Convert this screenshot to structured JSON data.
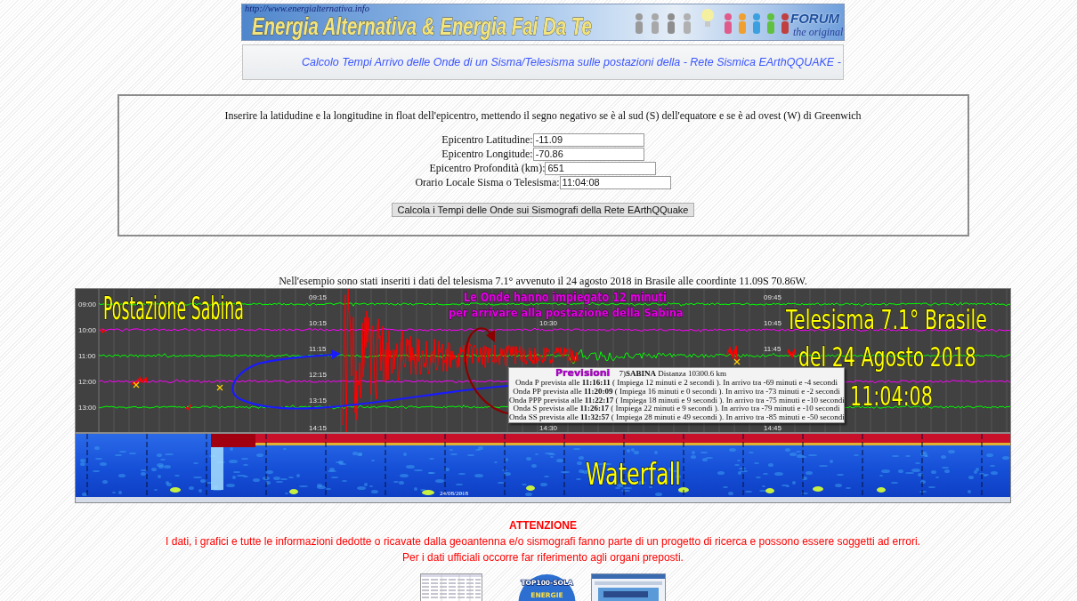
{
  "header": {
    "url": "http://www.energialternativa.info",
    "title": "Energia Alternativa & Energia Fai Da Te",
    "forum_title": "FORUM",
    "forum_subtitle": "the original"
  },
  "subheader": {
    "title": "Calcolo Tempi Arrivo delle Onde di un Sisma/Telesisma sulle postazioni della - Rete Sismica EArthQQUAKE -"
  },
  "form": {
    "instruction": "Inserire la latidudine e la longitudine in float dell'epicentro, mettendo il segno negativo se è al sud (S) dell'equatore e se è ad ovest (W) di Greenwich",
    "fields": [
      {
        "label": "Epicentro Latitudine:",
        "value": "-11.09"
      },
      {
        "label": "Epicentro Longitude:",
        "value": "-70.86"
      },
      {
        "label": "Epicentro Profondità (km):",
        "value": "651"
      },
      {
        "label": "Orario Locale Sisma o Telesisma:",
        "value": "11:04:08"
      }
    ],
    "submit_button": "Calcola i Tempi delle Onde sui Sismografi della Rete EArthQQuake"
  },
  "example_note": "Nell'esempio sono stati inseriti i dati del telesisma 7.1° avvenuto il 24 agosto 2018 in Brasile alle coordinte 11.09S 70.86W.",
  "seismogram": {
    "station_title": "Postazione Sabina",
    "rows": [
      {
        "time": "09:00",
        "color": "#00ff00",
        "column_2": "09:15",
        "column_4": "09:45"
      },
      {
        "time": "10:00",
        "color": "#ff00ff",
        "column_2": "10:15",
        "column_3": "10:30",
        "column_4": "10:45"
      },
      {
        "time": "11:00",
        "color": "#00ff00",
        "column_2": "11:15",
        "column_4": "11:45"
      },
      {
        "time": "12:00",
        "color": "#ff00ff",
        "column_2": "12:15"
      },
      {
        "time": "13:00",
        "color": "#00ff00",
        "column_2": "13:15"
      },
      {
        "column_2": "14:15",
        "column_3": "14:30",
        "column_4": "14:45"
      }
    ],
    "annotation": [
      "Le Onde hanno impiegato 12 minuti",
      "per arrivare alla postazione della Sabina"
    ],
    "event_title": [
      "Telesisma 7.1° Brasile",
      "del 24 Agosto 2018",
      "11:04:08"
    ],
    "forecast": {
      "title": "Previsioni",
      "station": "7)**SABINA** Distanza 10300.6 km",
      "lines": [
        "Onda P prevista alle **11:16:11** ( Impiega 12 minuti e 2 secondi ). In arrivo tra -69 minuti e -4 secondi",
        "Onda PP prevista alle **11:20:09** ( Impiega 16 minuti e 0 secondi ). In arrivo tra -73 minuti e -2 secondi",
        "Onda PPP prevista alle **11:22:17** ( Impiega 18 minuti e 9 secondi ). In arrivo tra -75 minuti e -10 secondi",
        "Onda S prevista alle **11:26:17** ( Impiega 22 minuti e 9 secondi ). In arrivo tra -79 minuti e -10 secondi",
        "Onda SS prevista alle **11:32:57** ( Impiega 28 minuti e 49 secondi ). In arrivo tra -85 minuti e -50 secondi"
      ]
    }
  },
  "waterfall": {
    "title": "Waterfall",
    "date": "24/08/2018"
  },
  "notice": {
    "title": "ATTENZIONE",
    "lines": [
      "I dati, i grafici e tutte le informazioni dedotte o ricavate dalla geoantenna e/o sismografi fanno parte di un progetto di ricerca e possono essere soggetti ad errori.",
      "Per i dati ufficiali occorre far riferimento agli organi preposti."
    ]
  },
  "footer_badges": [
    {
      "kind": "table_thumbnail"
    },
    {
      "kind": "solar_badge",
      "title": "TOP100-SOLA",
      "subtitle": "ENERGIE"
    },
    {
      "kind": "website_thumbnail"
    }
  ]
}
